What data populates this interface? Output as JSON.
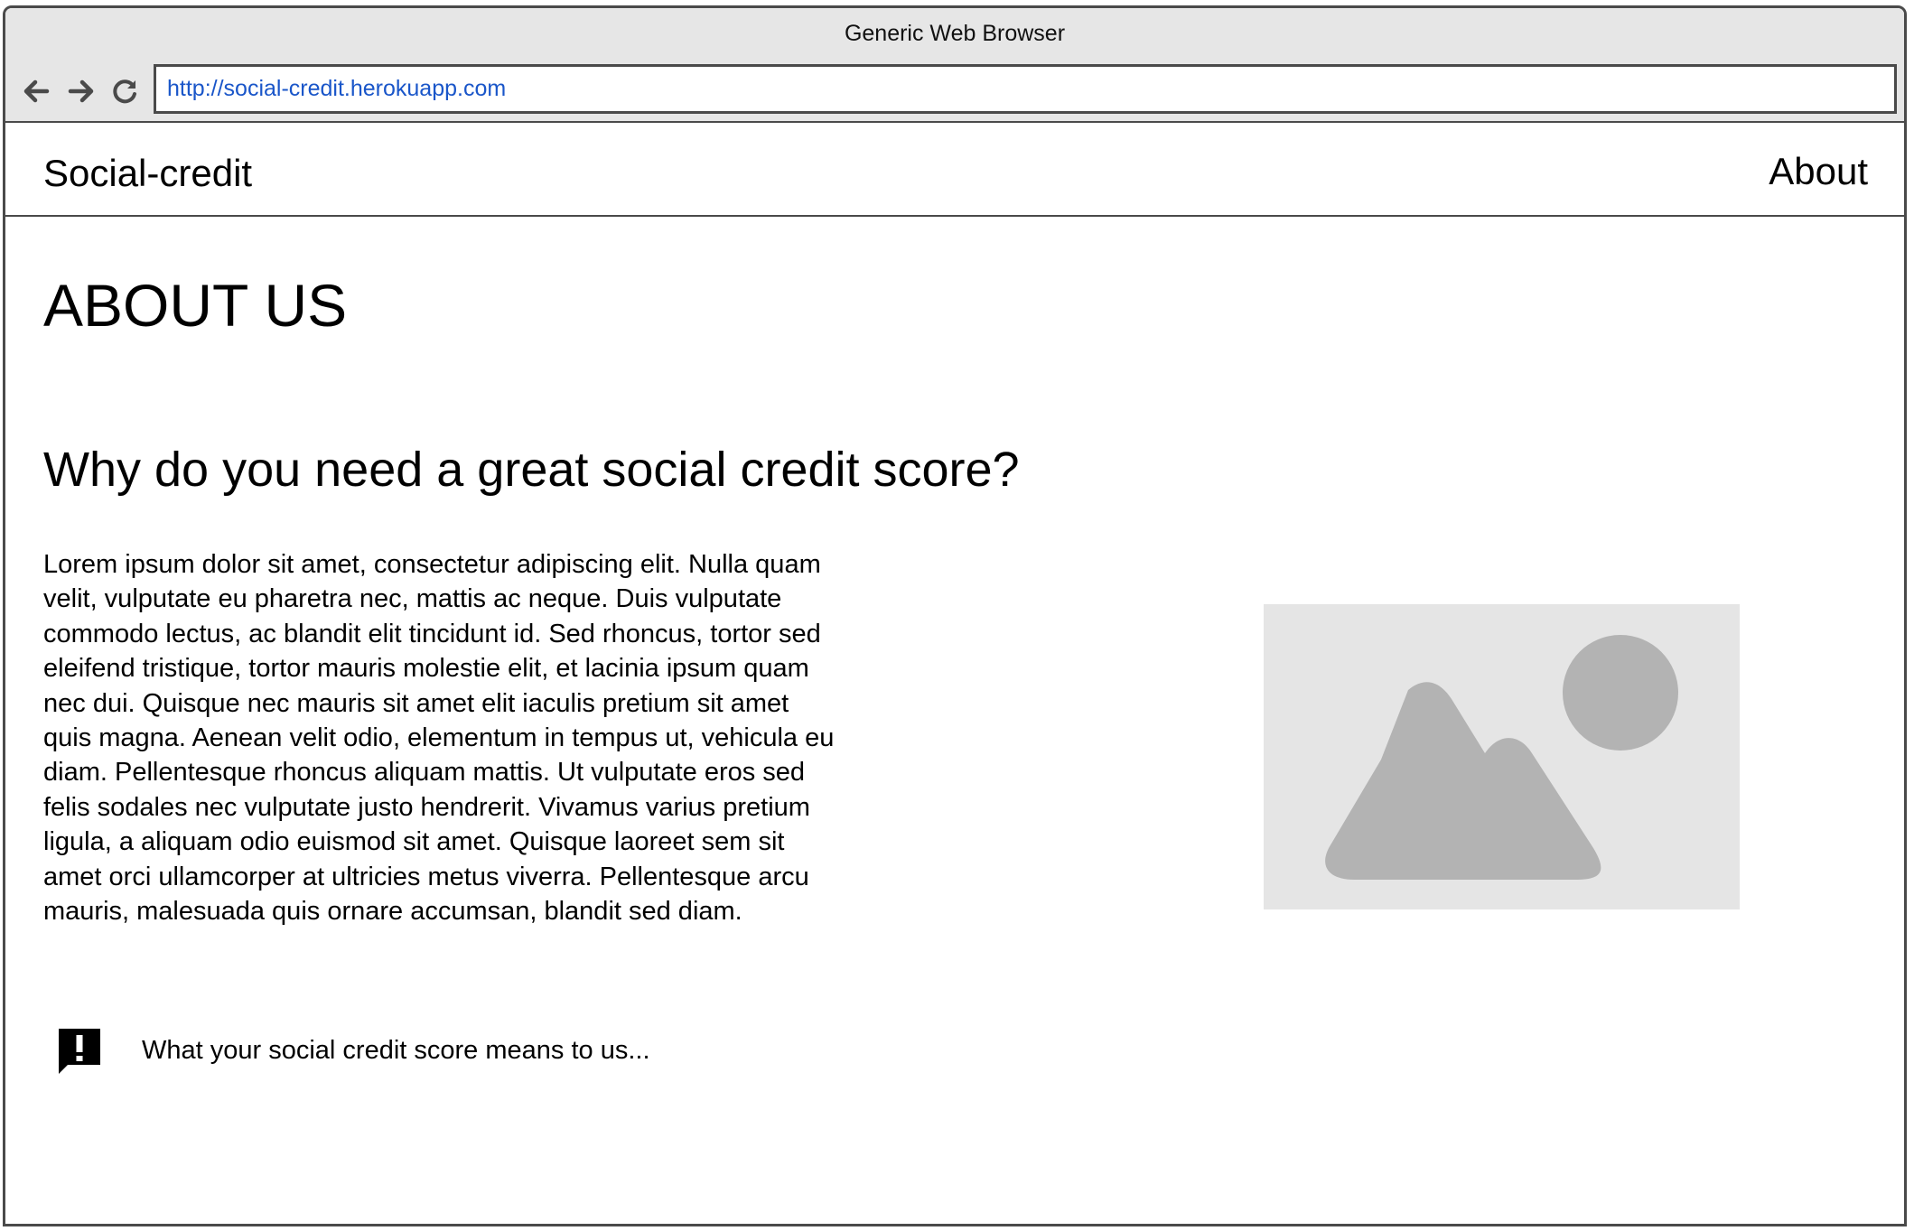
{
  "window": {
    "title": "Generic Web Browser"
  },
  "toolbar": {
    "back_icon": "arrow-left-icon",
    "forward_icon": "arrow-right-icon",
    "reload_icon": "reload-icon",
    "url": "http://social-credit.herokuapp.com"
  },
  "site_nav": {
    "brand": "Social-credit",
    "about_link": "About"
  },
  "main": {
    "heading": "ABOUT US",
    "subheading": "Why do you need a great social credit score?",
    "body": "Lorem ipsum dolor sit amet, consectetur adipiscing elit. Nulla quam velit, vulputate eu pharetra nec, mattis ac neque. Duis vulputate commodo lectus, ac blandit elit tincidunt id. Sed rhoncus, tortor sed eleifend tristique, tortor mauris molestie elit, et lacinia ipsum quam nec dui. Quisque nec mauris sit amet elit iaculis pretium sit amet quis magna. Aenean velit odio, elementum in tempus ut, vehicula eu diam. Pellentesque rhoncus aliquam mattis. Ut vulputate eros sed felis sodales nec vulputate justo hendrerit. Vivamus varius pretium ligula, a aliquam odio euismod sit amet. Quisque laoreet sem sit amet orci ullamcorper at ultricies metus viverra. Pellentesque arcu mauris, malesuada quis ornare accumsan, blandit sed diam.",
    "image_icon": "image-placeholder-icon",
    "notice_icon": "exclamation-comment-icon",
    "notice_text": "What your social credit score means to us..."
  },
  "colors": {
    "chrome_bg": "#e6e6e6",
    "border": "#4a4a4a",
    "url_text": "#1a56c9",
    "placeholder_bg": "#e5e5e5",
    "placeholder_shape": "#b3b3b3"
  }
}
